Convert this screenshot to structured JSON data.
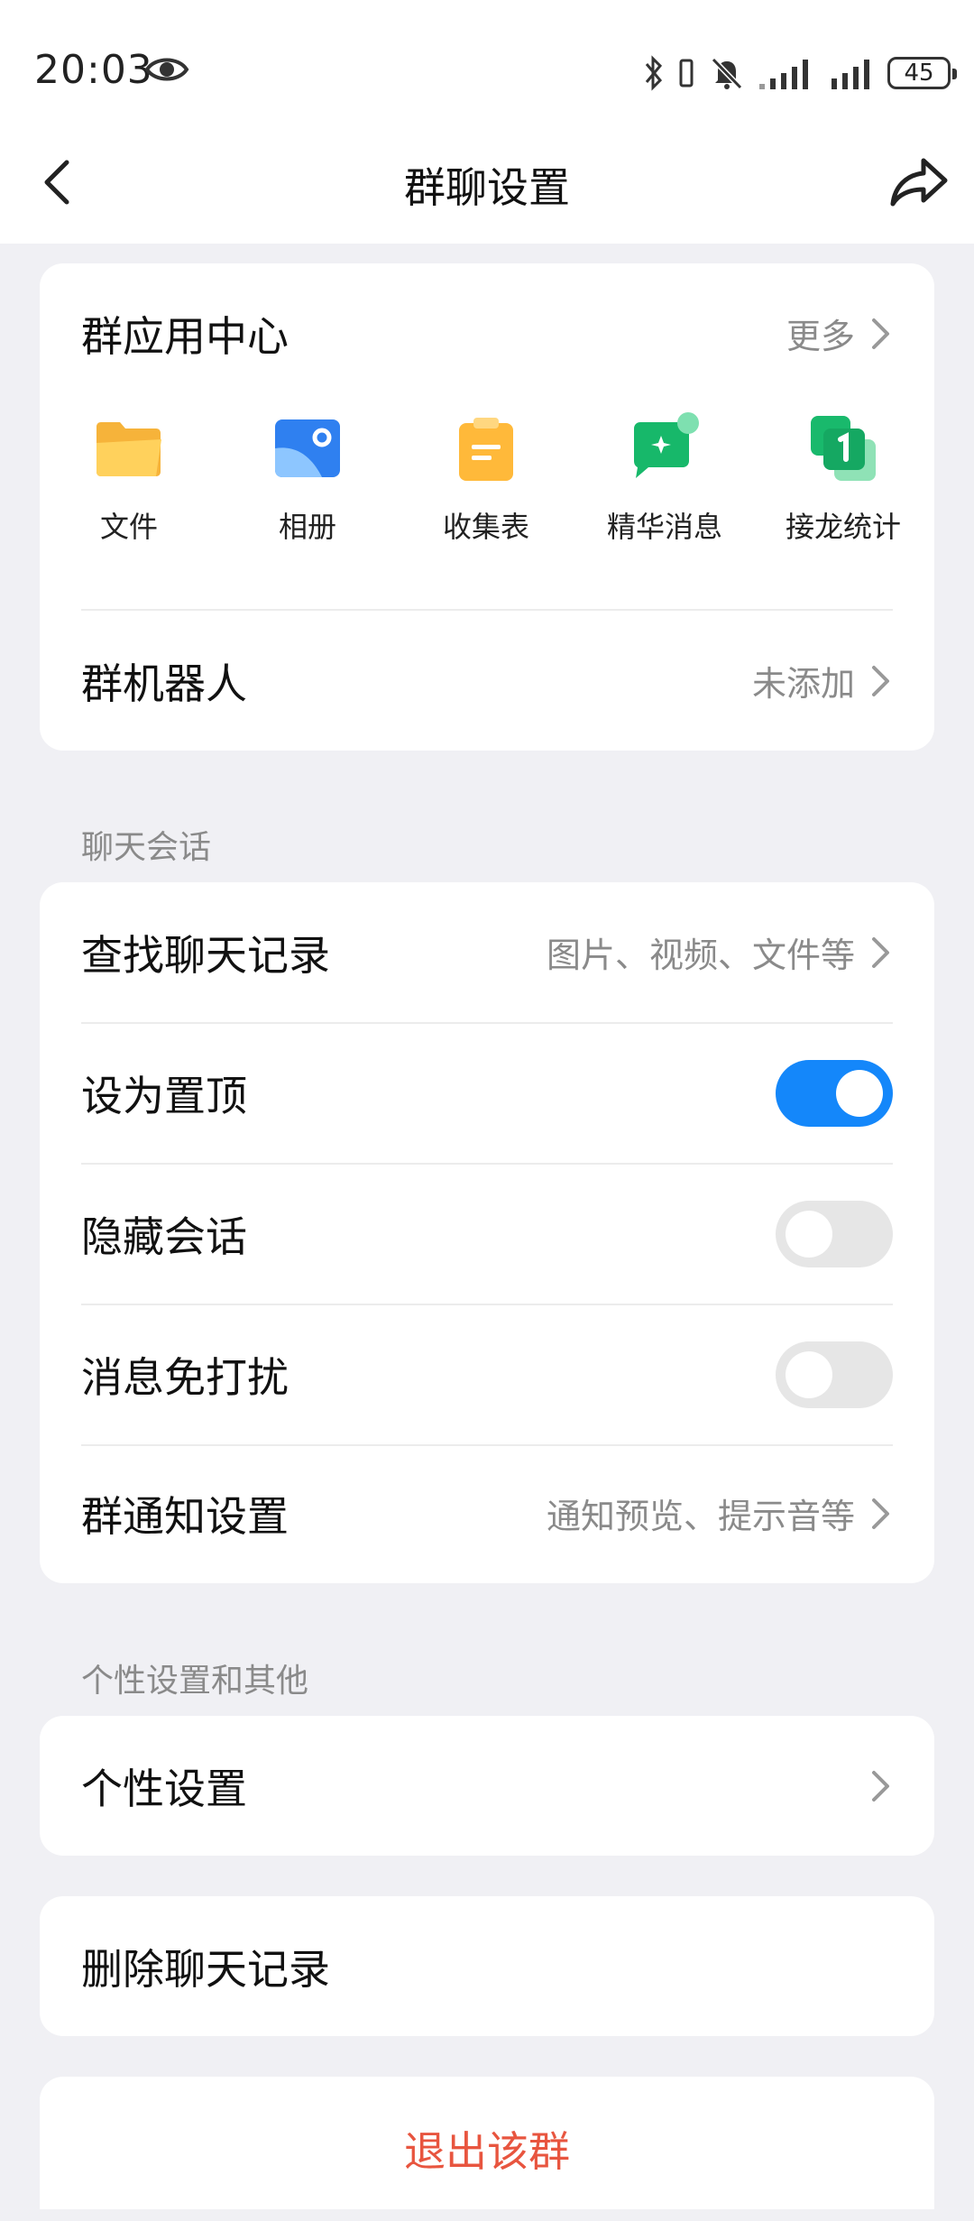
{
  "status_bar": {
    "time": "20:03",
    "battery": "45"
  },
  "header": {
    "title": "群聊设置"
  },
  "app_center": {
    "title": "群应用中心",
    "more_label": "更多",
    "apps": [
      {
        "label": "文件",
        "icon": "folder-icon"
      },
      {
        "label": "相册",
        "icon": "album-icon"
      },
      {
        "label": "收集表",
        "icon": "clipboard-icon"
      },
      {
        "label": "精华消息",
        "icon": "highlight-message-icon"
      },
      {
        "label": "接龙统计",
        "icon": "relay-stats-icon"
      }
    ],
    "robot": {
      "label": "群机器人",
      "value": "未添加"
    }
  },
  "chat_section": {
    "heading": "聊天会话",
    "find_history": {
      "label": "查找聊天记录",
      "value": "图片、视频、文件等"
    },
    "pin_top": {
      "label": "设为置顶",
      "on": true
    },
    "hide_chat": {
      "label": "隐藏会话",
      "on": false
    },
    "do_not_disturb": {
      "label": "消息免打扰",
      "on": false
    },
    "notify_settings": {
      "label": "群通知设置",
      "value": "通知预览、提示音等"
    }
  },
  "personal_section": {
    "heading": "个性设置和其他",
    "personal": {
      "label": "个性设置"
    }
  },
  "delete_history": {
    "label": "删除聊天记录"
  },
  "exit_group": {
    "label": "退出该群",
    "color": "#e8553f"
  },
  "colors": {
    "accent": "#1487fa",
    "background": "#f0f0f4"
  }
}
